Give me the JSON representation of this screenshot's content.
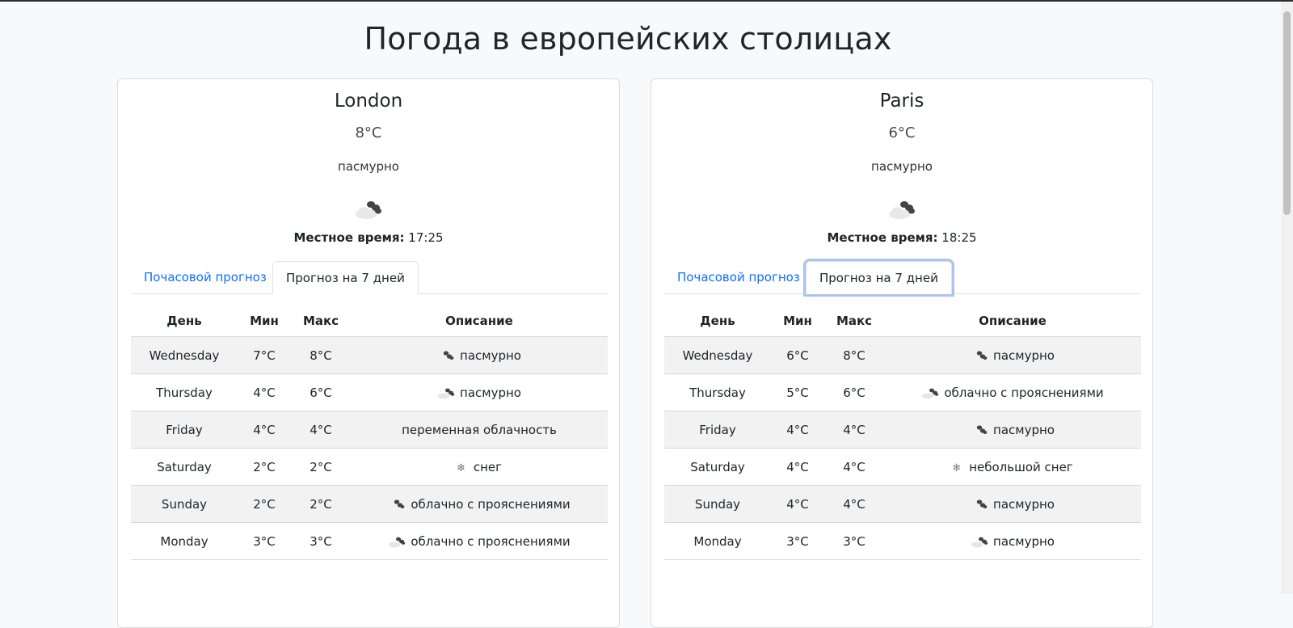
{
  "page": {
    "title": "Погода в европейских столицах"
  },
  "headers": {
    "day": "День",
    "min": "Мин",
    "max": "Макс",
    "desc": "Описание"
  },
  "cities": [
    {
      "name": "London",
      "temp": "8°C",
      "description": "пасмурно",
      "icon": "overcast-clouds-icon",
      "time_label": "Местное время:",
      "time": "17:25",
      "tabs": {
        "hourly": "Почасовой прогноз",
        "weekly": "Прогноз на 7 дней"
      },
      "forecast": [
        {
          "day": "Wednesday",
          "min": "7°C",
          "max": "8°C",
          "desc": "пасмурно",
          "icon": "broken-clouds-icon"
        },
        {
          "day": "Thursday",
          "min": "4°C",
          "max": "6°C",
          "desc": "пасмурно",
          "icon": "overcast-clouds-icon"
        },
        {
          "day": "Friday",
          "min": "4°C",
          "max": "4°C",
          "desc": "переменная облачность",
          "icon": ""
        },
        {
          "day": "Saturday",
          "min": "2°C",
          "max": "2°C",
          "desc": "снег",
          "icon": "snow-icon"
        },
        {
          "day": "Sunday",
          "min": "2°C",
          "max": "2°C",
          "desc": "облачно с прояснениями",
          "icon": "broken-clouds-icon"
        },
        {
          "day": "Monday",
          "min": "3°C",
          "max": "3°C",
          "desc": "облачно с прояснениями",
          "icon": "overcast-clouds-icon"
        }
      ]
    },
    {
      "name": "Paris",
      "temp": "6°C",
      "description": "пасмурно",
      "icon": "overcast-clouds-icon",
      "time_label": "Местное время:",
      "time": "18:25",
      "tabs": {
        "hourly": "Почасовой прогноз",
        "weekly": "Прогноз на 7 дней"
      },
      "forecast": [
        {
          "day": "Wednesday",
          "min": "6°C",
          "max": "8°C",
          "desc": "пасмурно",
          "icon": "broken-clouds-icon"
        },
        {
          "day": "Thursday",
          "min": "5°C",
          "max": "6°C",
          "desc": "облачно с прояснениями",
          "icon": "overcast-clouds-icon"
        },
        {
          "day": "Friday",
          "min": "4°C",
          "max": "4°C",
          "desc": "пасмурно",
          "icon": "broken-clouds-icon"
        },
        {
          "day": "Saturday",
          "min": "4°C",
          "max": "4°C",
          "desc": "небольшой снег",
          "icon": "snow-icon"
        },
        {
          "day": "Sunday",
          "min": "4°C",
          "max": "4°C",
          "desc": "пасмурно",
          "icon": "broken-clouds-icon"
        },
        {
          "day": "Monday",
          "min": "3°C",
          "max": "3°C",
          "desc": "пасмурно",
          "icon": "overcast-clouds-icon"
        }
      ]
    }
  ]
}
